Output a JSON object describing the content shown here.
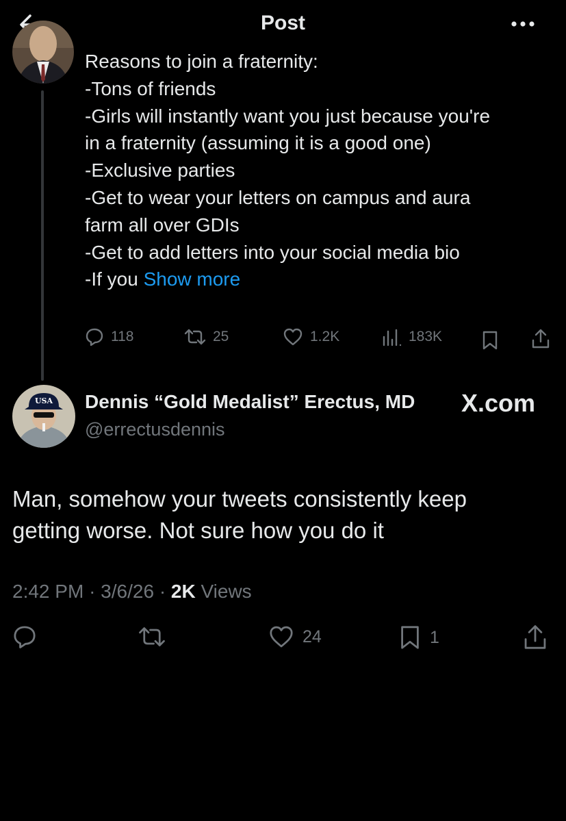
{
  "header": {
    "title": "Post",
    "back_icon": "arrow-left-icon",
    "more_icon": "ellipsis-icon"
  },
  "parent": {
    "lines": [
      "Reasons to join a fraternity:",
      "",
      "-Tons of friends",
      "-Girls will instantly want you just because you're",
      "in a fraternity (assuming it is a good one)",
      "-Exclusive parties",
      "-Get to wear your letters on campus and aura",
      "farm all over GDIs",
      "-Get to add letters into your social media bio"
    ],
    "last_line_prefix": "-If you ",
    "show_more": "Show more",
    "stats": {
      "replies": "118",
      "reposts": "25",
      "likes": "1.2K",
      "views": "183K"
    }
  },
  "reply": {
    "name": "Dennis “Gold Medalist” Erectus, MD",
    "handle": "@errectusdennis",
    "watermark": "X.com",
    "hat_text": "USA",
    "body_lines": [
      "Man, somehow your tweets consistently keep",
      "getting worse. Not sure how you do it"
    ],
    "time": "2:42 PM",
    "date": "3/6/26",
    "separator": "·",
    "views_count": "2K",
    "views_label": "Views",
    "stats": {
      "likes": "24",
      "bookmarks": "1"
    }
  },
  "colors": {
    "background": "#000000",
    "text": "#e7e9ea",
    "muted": "#71767b",
    "link": "#1d9bf0",
    "thread_line": "#333639"
  }
}
